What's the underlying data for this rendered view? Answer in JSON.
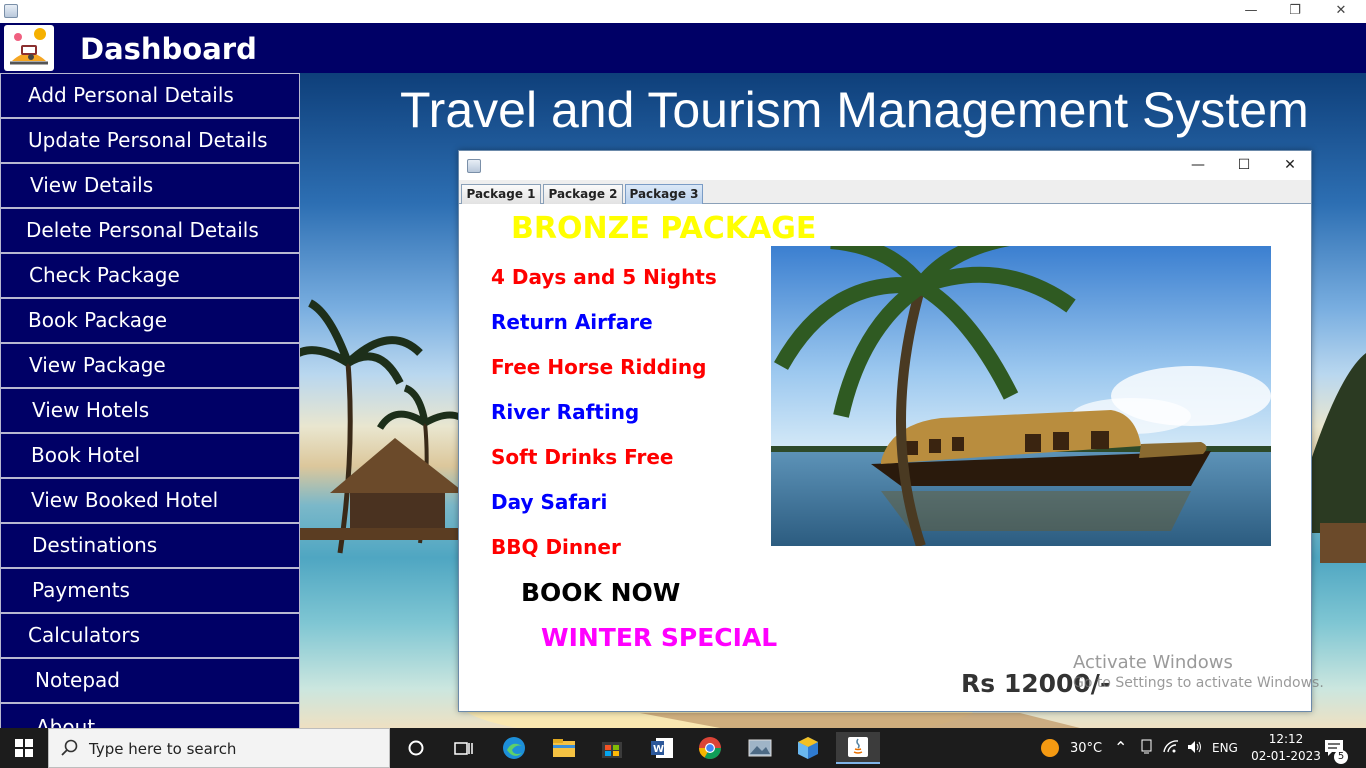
{
  "window": {
    "minimize": "—",
    "restore": "❐",
    "close": "✕"
  },
  "header": {
    "title": "Dashboard"
  },
  "sidebar": {
    "items": [
      "Add Personal Details",
      "Update Personal Details",
      "View Details",
      "Delete Personal Details",
      "Check Package",
      "Book Package",
      "View Package",
      "View Hotels",
      "Book Hotel",
      "View Booked Hotel",
      "Destinations",
      "Payments",
      "Calculators",
      "Notepad",
      "About"
    ]
  },
  "main": {
    "title": "Travel and Tourism Management System"
  },
  "package_window": {
    "controls": {
      "minimize": "—",
      "maximize": "☐",
      "close": "✕"
    },
    "tabs": [
      "Package 1",
      "Package 2",
      "Package 3"
    ],
    "active_tab": "Package 3",
    "title": "BRONZE PACKAGE",
    "features": [
      {
        "text": "4 Days and 5 Nights",
        "color": "red"
      },
      {
        "text": "Return Airfare",
        "color": "blue"
      },
      {
        "text": "Free Horse Ridding",
        "color": "red"
      },
      {
        "text": "River Rafting",
        "color": "blue"
      },
      {
        "text": "Soft Drinks Free",
        "color": "red"
      },
      {
        "text": "Day Safari",
        "color": "blue"
      },
      {
        "text": "BBQ Dinner",
        "color": "red"
      }
    ],
    "book_now": "BOOK NOW",
    "special": "WINTER SPECIAL",
    "price": "Rs 12000/-"
  },
  "watermark": {
    "line1": "Activate Windows",
    "line2": "Go to Settings to activate Windows."
  },
  "taskbar": {
    "search_placeholder": "Type here to search",
    "weather": "30°C",
    "language": "ENG",
    "time": "12:12",
    "date": "02-01-2023",
    "notifications": "5"
  },
  "colors": {
    "navy": "#000066",
    "title_yellow": "#ffff00",
    "special_magenta": "#ff00ff"
  }
}
